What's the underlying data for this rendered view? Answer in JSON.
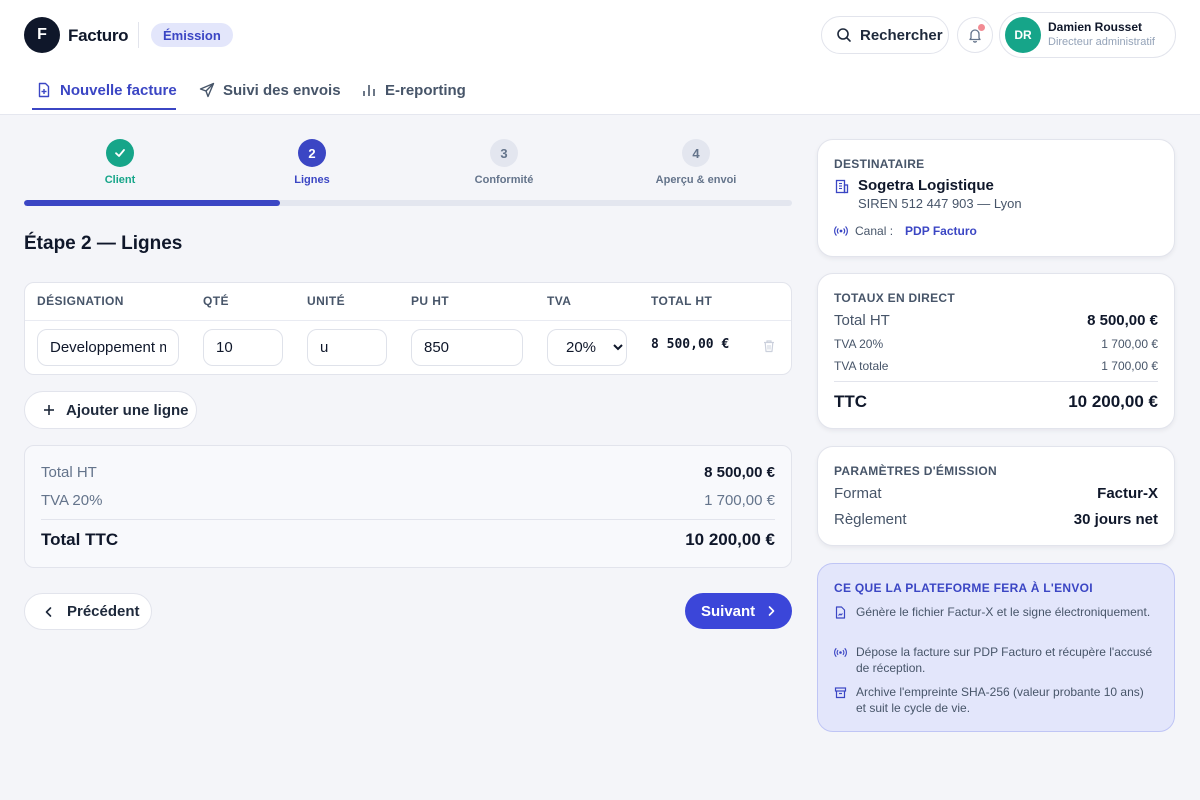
{
  "app": {
    "logo_letter": "F",
    "name": "Facturo",
    "mode": "Émission"
  },
  "header": {
    "search_label": "Rechercher"
  },
  "user": {
    "initials": "DR",
    "name": "Damien Rousset",
    "role": "Directeur administratif"
  },
  "nav": {
    "tabs": [
      {
        "label": "Nouvelle facture"
      },
      {
        "label": "Suivi des envois"
      },
      {
        "label": "E-reporting"
      }
    ],
    "active_index": 0
  },
  "stepper": {
    "progress": 0.333,
    "steps": [
      {
        "number": "1",
        "label": "Client",
        "state": "done"
      },
      {
        "number": "2",
        "label": "Lignes",
        "state": "current"
      },
      {
        "number": "3",
        "label": "Conformité",
        "state": "todo"
      },
      {
        "number": "4",
        "label": "Aperçu & envoi",
        "state": "todo"
      }
    ]
  },
  "main": {
    "title": "Étape 2 — Lignes",
    "table": {
      "columns": [
        "DÉSIGNATION",
        "QTÉ",
        "UNITÉ",
        "PU HT",
        "TVA",
        "TOTAL HT"
      ],
      "rows": [
        {
          "designation": "Developpement module",
          "qty": "10",
          "unit": "u",
          "unit_price": "850",
          "vat": "20%",
          "total": "8 500,00 €"
        }
      ],
      "vat_options": [
        "20%"
      ]
    },
    "add_line_label": "Ajouter une ligne",
    "totals": {
      "ht_label": "Total HT",
      "ht_value": "8 500,00 €",
      "tva_label": "TVA 20%",
      "tva_value": "1 700,00 €",
      "ttc_label": "Total TTC",
      "ttc_value": "10 200,00 €"
    },
    "prev_label": "Précédent",
    "next_label": "Suivant"
  },
  "recipient": {
    "title": "DESTINATAIRE",
    "name": "Sogetra Logistique",
    "siren": "SIREN 512 447 903 — Lyon",
    "channel_label": "Canal :",
    "channel_value": "PDP Facturo"
  },
  "live_totals": {
    "title": "TOTAUX EN DIRECT",
    "ht_label": "Total HT",
    "ht_value": "8 500,00 €",
    "tva20_label": "TVA 20%",
    "tva20_value": "1 700,00 €",
    "tva_total_label": "TVA totale",
    "tva_total_value": "1 700,00 €",
    "ttc_label": "TTC",
    "ttc_value": "10 200,00 €"
  },
  "params": {
    "title": "PARAMÈTRES D'ÉMISSION",
    "format_label": "Format",
    "format_value": "Factur-X",
    "payment_label": "Règlement",
    "payment_value": "30 jours net"
  },
  "platform_info": {
    "title": "CE QUE LA PLATEFORME FERA À L'ENVOI",
    "items": [
      {
        "icon": "file-sign-icon",
        "text": "Génère le fichier Factur-X et le signe électroniquement."
      },
      {
        "icon": "broadcast-icon",
        "text": "Dépose la facture sur PDP Facturo et récupère l'accusé de réception."
      },
      {
        "icon": "archive-icon",
        "text": "Archive l'empreinte SHA-256 (valeur probante 10 ans) et suit le cycle de vie."
      }
    ]
  },
  "colors": {
    "accent": "#3b46c4",
    "success": "#16a589",
    "dark": "#0f172a",
    "info_bg": "#e3e6fb"
  }
}
